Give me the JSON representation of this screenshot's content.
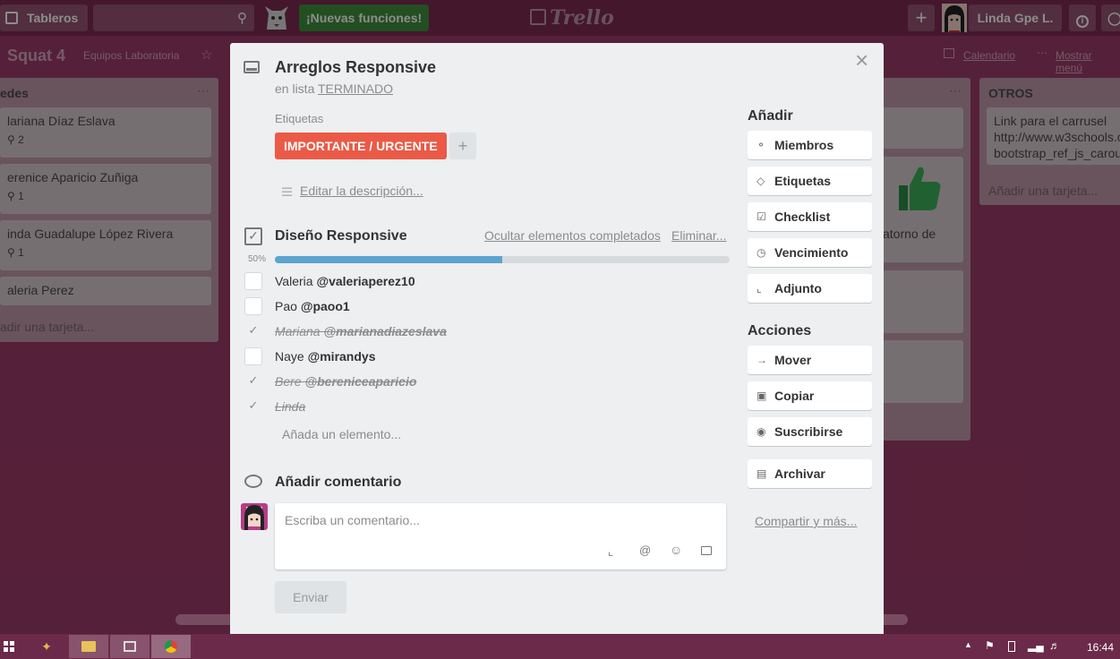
{
  "header": {
    "boards_label": "Tableros",
    "new_features": "¡Nuevas funciones!",
    "logo": "Trello",
    "user_name": "Linda Gpe L."
  },
  "board": {
    "name": "Squat 4",
    "team": "Equipos Laboratoria",
    "calendar": "Calendario",
    "menu": "Mostrar menú"
  },
  "lists": {
    "left": {
      "title": "edes",
      "cards": [
        {
          "title": "lariana Díaz Eslava",
          "meta": "2"
        },
        {
          "title": "erenice Aparicio Zuñiga",
          "meta": "1"
        },
        {
          "title": "inda Guadalupe López Rivera",
          "meta": "1"
        },
        {
          "title": "aleria Perez",
          "meta": ""
        }
      ],
      "add": "adir una tarjeta..."
    },
    "middle_fragment": "atorno de",
    "otros": {
      "title": "OTROS",
      "card_lines": [
        "Link para el carrusel",
        "http://www.w3schools.c",
        "bootstrap_ref_js_carou"
      ],
      "add": "Añadir una tarjeta..."
    }
  },
  "modal": {
    "title": "Arreglos Responsive",
    "in_list_prefix": "en lista",
    "list_name": "TERMINADO",
    "labels_heading": "Etiquetas",
    "label": "IMPORTANTE / URGENTE",
    "label_color": "#eb5a46",
    "edit_description": "Editar la descripción...",
    "checklist": {
      "title": "Diseño Responsive",
      "hide_completed": "Ocultar elementos completados",
      "delete": "Eliminar...",
      "progress_label": "50%",
      "progress": 0.5,
      "progress_color": "#5ba4cf",
      "items": [
        {
          "name": "Valeria",
          "handle": "@valeriaperez10",
          "done": false
        },
        {
          "name": "Pao",
          "handle": "@paoo1",
          "done": false
        },
        {
          "name": "Mariana",
          "handle": "@marianadiazeslava",
          "done": true
        },
        {
          "name": "Naye",
          "handle": "@mirandys",
          "done": false
        },
        {
          "name": "Bere",
          "handle": "@bereniceaparicio",
          "done": true
        },
        {
          "name": "Linda",
          "handle": "",
          "done": true
        }
      ],
      "add_item": "Añada un elemento..."
    },
    "comment": {
      "heading": "Añadir comentario",
      "placeholder": "Escriba un comentario...",
      "send": "Enviar"
    },
    "sidebar": {
      "add_heading": "Añadir",
      "add_buttons": [
        "Miembros",
        "Etiquetas",
        "Checklist",
        "Vencimiento",
        "Adjunto"
      ],
      "actions_heading": "Acciones",
      "action_buttons": [
        "Mover",
        "Copiar",
        "Suscribirse",
        "Archivar"
      ],
      "share": "Compartir y más..."
    }
  },
  "taskbar": {
    "time": "16:44"
  }
}
